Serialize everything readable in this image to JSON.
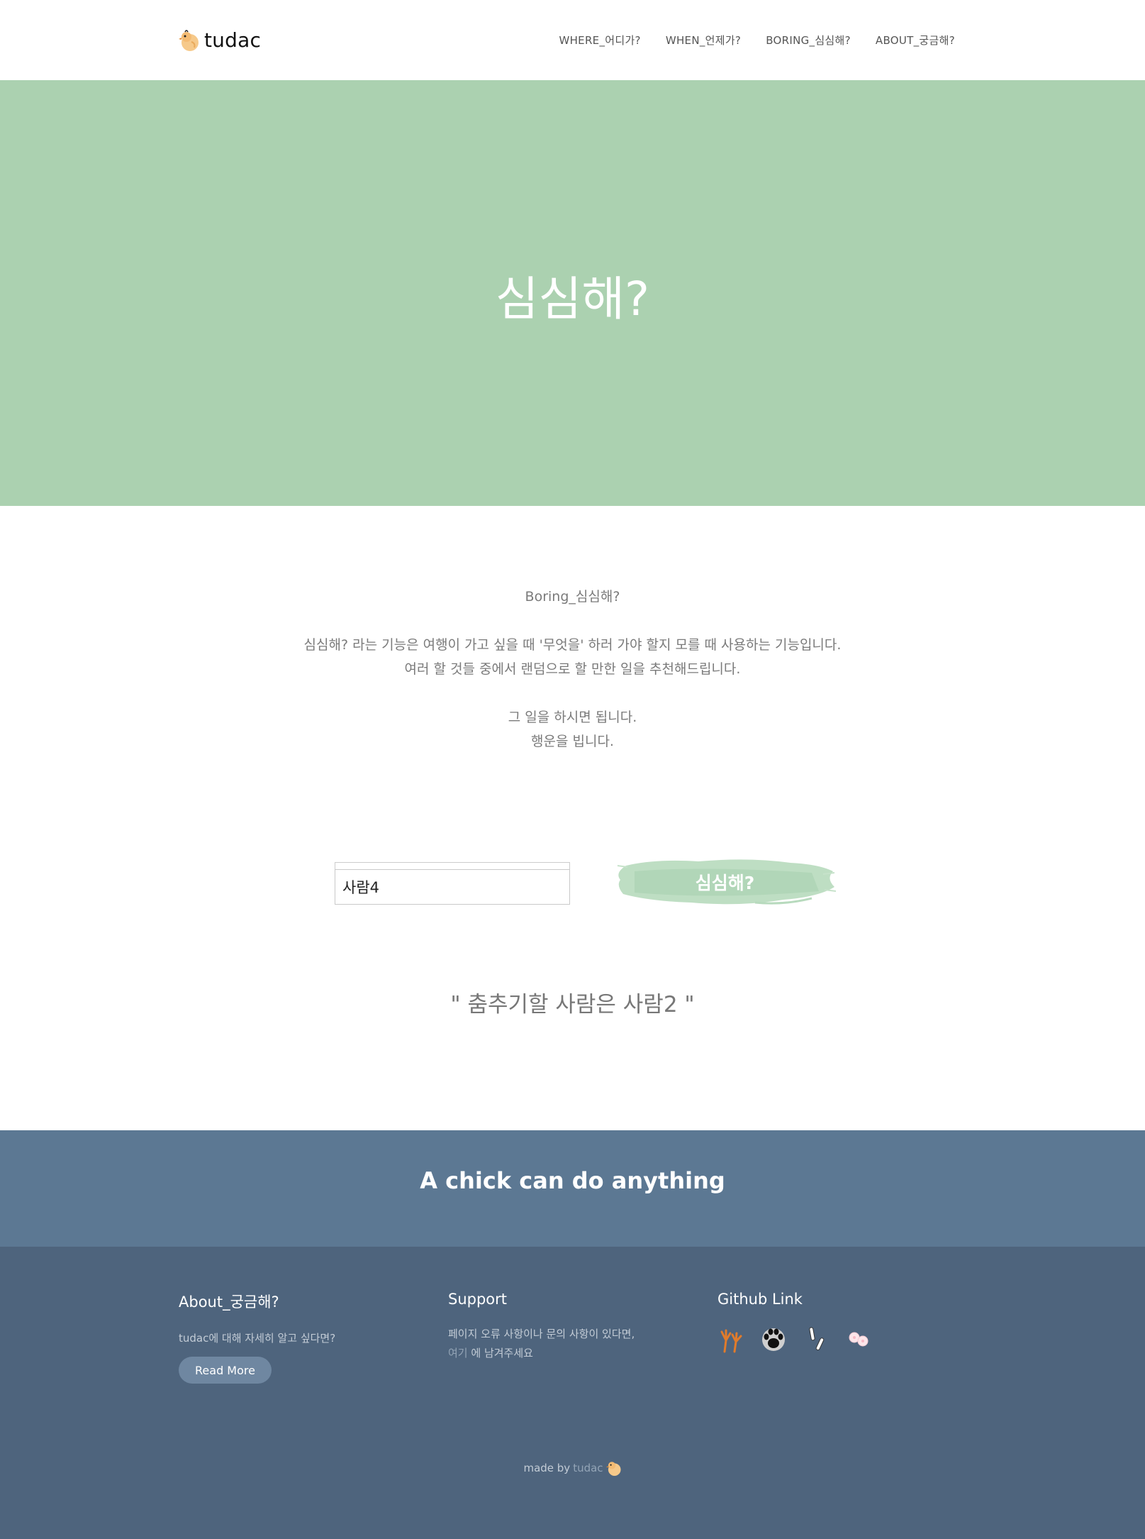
{
  "header": {
    "brand": "tudac",
    "nav": [
      "WHERE_어디가?",
      "WHEN_언제가?",
      "BORING_심심해?",
      "ABOUT_궁금해?"
    ]
  },
  "hero": {
    "title": "심심해?"
  },
  "intro": {
    "heading": "Boring_심심해?",
    "line1": "심심해? 라는 기능은 여행이 가고 싶을 때 '무엇을' 하러 가야 할지 모를 때 사용하는 기능입니다.",
    "line2": "여러 할 것들 중에서 랜덤으로 할 만한 일을 추천해드립니다.",
    "line3": "그 일을 하시면 됩니다.",
    "line4": "행운을 빕니다."
  },
  "form": {
    "input_value": "사람4",
    "button_label": "심심해?"
  },
  "result": {
    "text": "\" 춤추기할 사람은 사람2 \""
  },
  "band": {
    "text": "A chick can do anything"
  },
  "footer": {
    "about": {
      "title": "About_궁금해?",
      "text": "tudac에 대해 자세히 알고 싶다면?",
      "button": "Read More"
    },
    "support": {
      "title": "Support",
      "line1": "페이지 오류 사항이나 문의 사항이 있다면,",
      "link": "여기",
      "line2_rest": " 에 남겨주세요"
    },
    "github": {
      "title": "Github Link",
      "icons": [
        "chicken-feet-icon",
        "paw-icon",
        "bandage-icon",
        "petals-icon"
      ]
    },
    "credit": {
      "prefix": "made by",
      "name": "tudac"
    }
  },
  "colors": {
    "hero_bg": "#abd1b0",
    "band_bg": "#5c7893",
    "footer_bg": "#4e647d",
    "button_green": "#b5d8bc"
  }
}
